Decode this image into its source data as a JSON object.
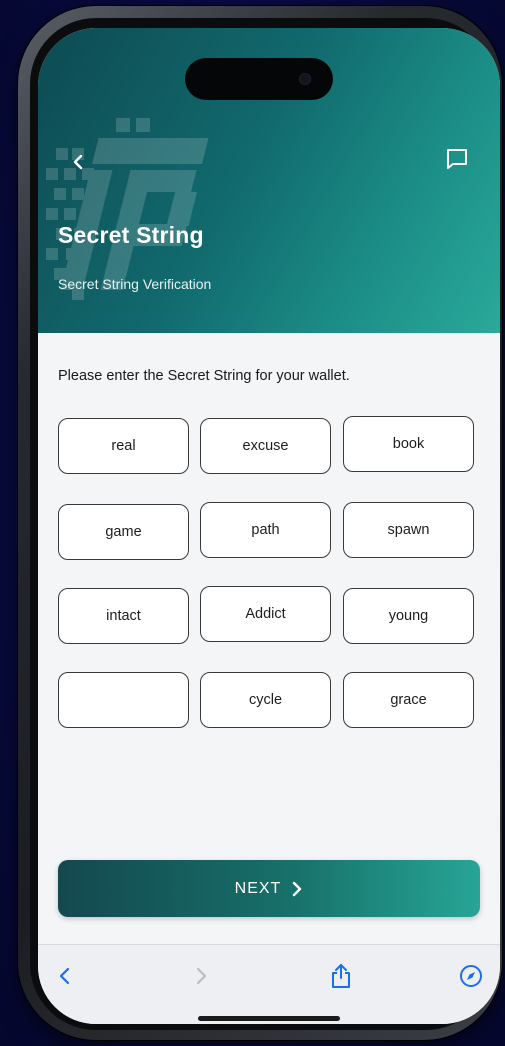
{
  "header": {
    "title": "Secret String",
    "subtitle": "Secret String Verification"
  },
  "instruction": "Please enter the Secret String for your wallet.",
  "words": [
    [
      "real",
      "excuse",
      "book"
    ],
    [
      "game",
      "path",
      "spawn"
    ],
    [
      "intact",
      "Addict",
      "young"
    ],
    [
      "",
      "cycle",
      "grace"
    ]
  ],
  "next_label": "NEXT",
  "icons": {
    "back": "chevron-left-icon",
    "chat": "chat-bubble-icon",
    "browser_back": "chevron-left-icon",
    "browser_forward": "chevron-right-icon",
    "share": "share-icon",
    "compass": "compass-icon"
  },
  "colors": {
    "header_start": "#0e4a52",
    "header_end": "#2aa99a",
    "accent_blue": "#1a6ff0",
    "background": "#070a3d"
  }
}
